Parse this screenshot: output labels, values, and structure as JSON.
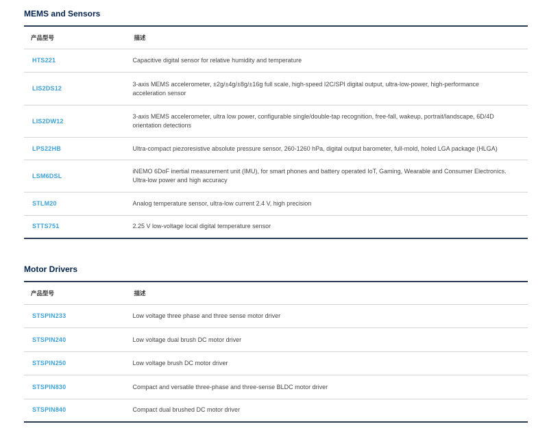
{
  "sections": [
    {
      "title": "MEMS and Sensors",
      "headers": {
        "part": "产品型号",
        "description": "描述"
      },
      "rows": [
        {
          "part": "HTS221",
          "description": "Capacitive digital sensor for relative humidity and temperature"
        },
        {
          "part": "LIS2DS12",
          "description": "3-axis MEMS accelerometer, ±2g/±4g/±8g/±16g full scale, high-speed I2C/SPI digital output, ultra-low-power, high-performance acceleration sensor"
        },
        {
          "part": "LIS2DW12",
          "description": "3-axis MEMS accelerometer, ultra low power, configurable single/double-tap recognition, free-fall, wakeup, portrait/landscape, 6D/4D orientation detections"
        },
        {
          "part": "LPS22HB",
          "description": "Ultra-compact piezoresistive absolute pressure sensor, 260-1260 hPa, digital output barometer, full-mold, holed LGA package (HLGA)"
        },
        {
          "part": "LSM6DSL",
          "description": "iNEMO 6DoF inertial measurement unit (IMU), for smart phones and battery operated IoT, Gaming, Wearable and Consumer Electronics. Ultra-low power and high accuracy"
        },
        {
          "part": "STLM20",
          "description": "Analog temperature sensor, ultra-low current 2.4 V, high precision"
        },
        {
          "part": "STTS751",
          "description": "2.25 V low-voltage local digital temperature sensor"
        }
      ]
    },
    {
      "title": "Motor Drivers",
      "headers": {
        "part": "产品型号",
        "description": "描述"
      },
      "rows": [
        {
          "part": "STSPIN233",
          "description": "Low voltage three phase and three sense motor driver"
        },
        {
          "part": "STSPIN240",
          "description": "Low voltage dual brush DC motor driver"
        },
        {
          "part": "STSPIN250",
          "description": "Low voltage brush DC motor driver"
        },
        {
          "part": "STSPIN830",
          "description": "Compact and versatile three-phase and three-sense BLDC motor driver"
        },
        {
          "part": "STSPIN840",
          "description": "Compact dual brushed DC motor driver"
        }
      ]
    }
  ]
}
